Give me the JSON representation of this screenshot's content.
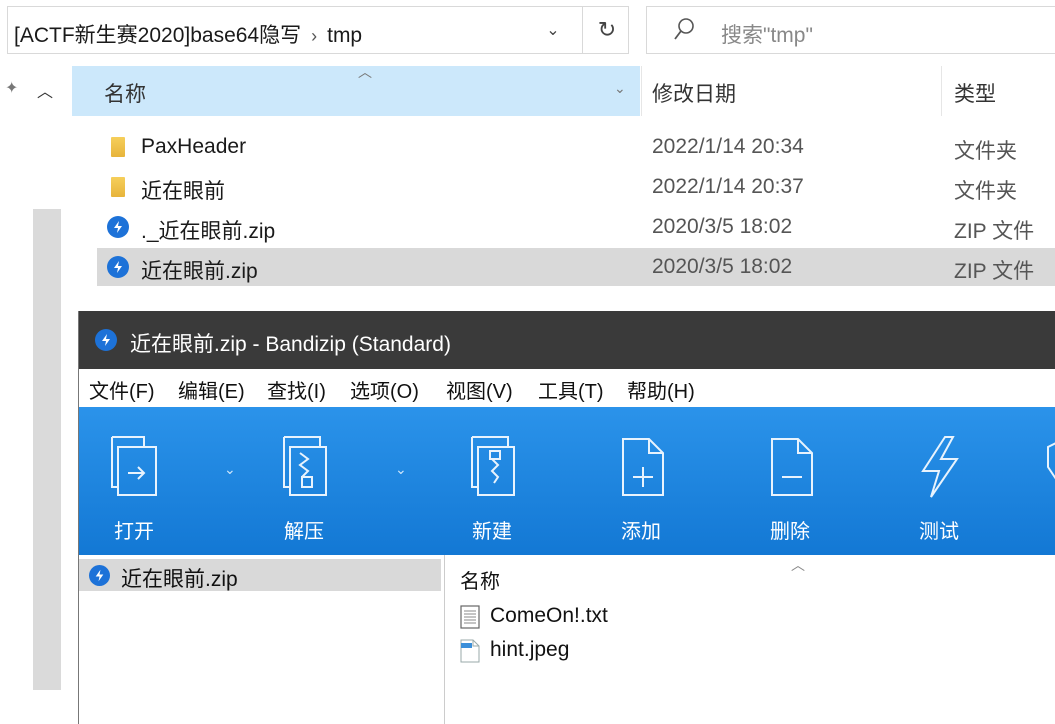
{
  "explorer": {
    "breadcrumb": {
      "folder": "[ACTF新生赛2020]base64隐写",
      "separator": "›",
      "current": "tmp"
    },
    "search_placeholder": "搜索\"tmp\"",
    "columns": {
      "name": "名称",
      "date": "修改日期",
      "type": "类型"
    },
    "files": [
      {
        "name": "PaxHeader",
        "date": "2022/1/14 20:34",
        "type": "文件夹",
        "icon": "folder-icon"
      },
      {
        "name": "近在眼前",
        "date": "2022/1/14 20:37",
        "type": "文件夹",
        "icon": "folder-icon"
      },
      {
        "name": "._近在眼前.zip",
        "date": "2020/3/5 18:02",
        "type": "ZIP 文件",
        "icon": "bandizip-zip-icon"
      },
      {
        "name": "近在眼前.zip",
        "date": "2020/3/5 18:02",
        "type": "ZIP 文件",
        "icon": "bandizip-zip-icon",
        "selected": true
      }
    ]
  },
  "bandizip": {
    "title": "近在眼前.zip - Bandizip (Standard)",
    "menu": [
      "文件(F)",
      "编辑(E)",
      "查找(I)",
      "选项(O)",
      "视图(V)",
      "工具(T)",
      "帮助(H)"
    ],
    "toolbar": {
      "open": "打开",
      "extract": "解压",
      "new": "新建",
      "add": "添加",
      "delete": "删除",
      "test": "测试"
    },
    "tree_item": "近在眼前.zip",
    "list_header": "名称",
    "files": [
      {
        "name": "ComeOn!.txt",
        "icon": "text-file-icon"
      },
      {
        "name": "hint.jpeg",
        "icon": "image-file-icon"
      }
    ]
  },
  "colors": {
    "selection": "#d9d9d9",
    "header_highlight": "#cce8fb",
    "toolbar_blue": "#1e84df",
    "zip_icon_blue": "#1d72d8",
    "titlebar": "#3a3a3a"
  }
}
